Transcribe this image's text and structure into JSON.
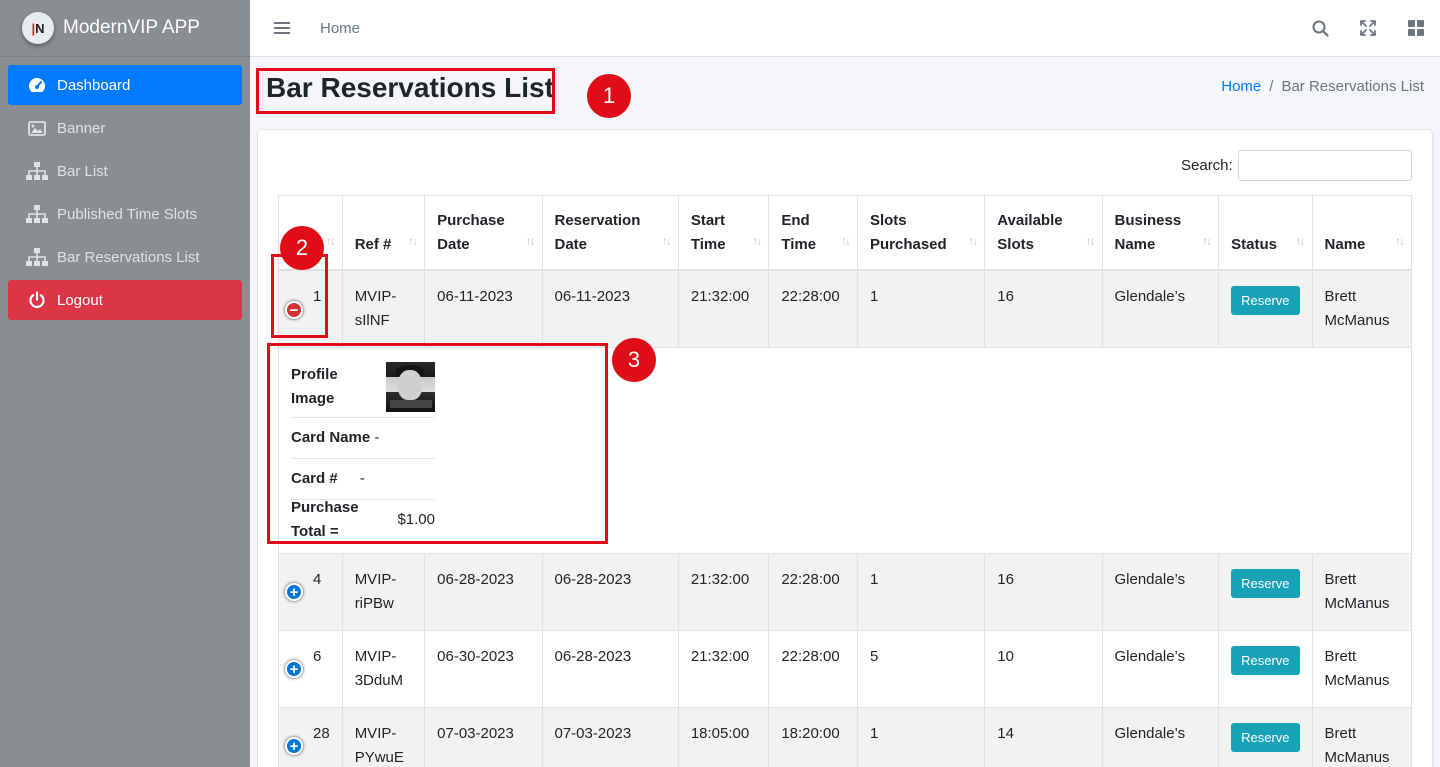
{
  "app": {
    "brand_name": "ModernVIP APP",
    "logo_text": "N"
  },
  "sidebar": {
    "items": [
      {
        "label": "Dashboard",
        "icon": "speedometer-icon",
        "state": "active"
      },
      {
        "label": "Banner",
        "icon": "image-icon",
        "state": "normal"
      },
      {
        "label": "Bar List",
        "icon": "sitemap-icon",
        "state": "normal"
      },
      {
        "label": "Published Time Slots",
        "icon": "sitemap-icon",
        "state": "normal"
      },
      {
        "label": "Bar Reservations List",
        "icon": "sitemap-icon",
        "state": "normal"
      },
      {
        "label": "Logout",
        "icon": "power-icon",
        "state": "danger"
      }
    ]
  },
  "topbar": {
    "home_link": "Home",
    "icons": [
      "menu-icon",
      "search-icon",
      "fullscreen-icon",
      "apps-grid-icon"
    ]
  },
  "page": {
    "title": "Bar Reservations List",
    "breadcrumb": {
      "home": "Home",
      "separator": "/",
      "current": "Bar Reservations List"
    }
  },
  "annotations": {
    "marker_1": "1",
    "marker_2": "2",
    "marker_3": "3",
    "color": "#e00d18"
  },
  "table": {
    "search_label": "Search:",
    "columns": [
      "",
      "Ref #",
      "Purchase Date",
      "Reservation Date",
      "Start Time",
      "End Time",
      "Slots Purchased",
      "Available Slots",
      "Business Name",
      "Status",
      "Name"
    ],
    "rows": [
      {
        "id": "1",
        "ref": "MVIP-sIlNF",
        "purchase_date": "06-11-2023",
        "reservation_date": "06-11-2023",
        "start": "21:32:00",
        "end": "22:28:00",
        "slots_purchased": "1",
        "available": "16",
        "business": "Glendale’s",
        "status": "Reserve",
        "name": "Brett McManus",
        "expanded": true
      },
      {
        "id": "4",
        "ref": "MVIP-riPBw",
        "purchase_date": "06-28-2023",
        "reservation_date": "06-28-2023",
        "start": "21:32:00",
        "end": "22:28:00",
        "slots_purchased": "1",
        "available": "16",
        "business": "Glendale’s",
        "status": "Reserve",
        "name": "Brett McManus",
        "expanded": false
      },
      {
        "id": "6",
        "ref": "MVIP-3DduM",
        "purchase_date": "06-30-2023",
        "reservation_date": "06-28-2023",
        "start": "21:32:00",
        "end": "22:28:00",
        "slots_purchased": "5",
        "available": "10",
        "business": "Glendale’s",
        "status": "Reserve",
        "name": "Brett McManus",
        "expanded": false
      },
      {
        "id": "28",
        "ref": "MVIP-PYwuE",
        "purchase_date": "07-03-2023",
        "reservation_date": "07-03-2023",
        "start": "18:05:00",
        "end": "18:20:00",
        "slots_purchased": "1",
        "available": "14",
        "business": "Glendale’s",
        "status": "Reserve",
        "name": "Brett McManus",
        "expanded": false
      }
    ],
    "child": {
      "profile_label": "Profile Image",
      "card_name_label": "Card Name",
      "card_name_value": "-",
      "card_no_label": "Card #",
      "card_no_value": "-",
      "total_label": "Purchase Total =",
      "total_value": "$1.00"
    }
  },
  "colors": {
    "sidebar_bg": "#8a8d91",
    "active": "#007bff",
    "logout": "#dc3545",
    "reserve": "#17a2b8"
  }
}
